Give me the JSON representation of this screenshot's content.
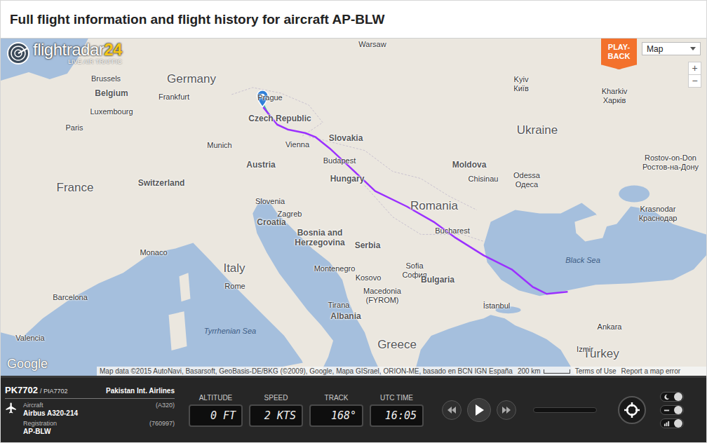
{
  "page": {
    "title": "Full flight information and flight history for aircraft AP-BLW"
  },
  "logo": {
    "name": "flightradar",
    "suffix": "24",
    "tagline": "LIVE AIR TRAFFIC"
  },
  "map": {
    "playback": [
      "PLAY-",
      "BACK"
    ],
    "type_select": {
      "value": "Map"
    },
    "zoom": [
      "+",
      "−"
    ],
    "labels": [
      {
        "lines": [
          "Warsaw"
        ],
        "kind": "city"
      },
      {
        "lines": [
          "Germany"
        ],
        "kind": "country"
      },
      {
        "lines": [
          "Brussels"
        ],
        "kind": "city"
      },
      {
        "lines": [
          "Belgium"
        ],
        "kind": "region"
      },
      {
        "lines": [
          "Frankfurt"
        ],
        "kind": "city"
      },
      {
        "lines": [
          "Luxembourg"
        ],
        "kind": "city"
      },
      {
        "lines": [
          "Paris"
        ],
        "kind": "city"
      },
      {
        "lines": [
          "France"
        ],
        "kind": "country"
      },
      {
        "lines": [
          "Prague"
        ],
        "kind": "city"
      },
      {
        "lines": [
          "Czech Republic"
        ],
        "kind": "region"
      },
      {
        "lines": [
          "Munich"
        ],
        "kind": "city"
      },
      {
        "lines": [
          "Vienna"
        ],
        "kind": "city"
      },
      {
        "lines": [
          "Slovakia"
        ],
        "kind": "region"
      },
      {
        "lines": [
          "Austria"
        ],
        "kind": "region"
      },
      {
        "lines": [
          "Switzerland"
        ],
        "kind": "region"
      },
      {
        "lines": [
          "Budapest"
        ],
        "kind": "city"
      },
      {
        "lines": [
          "Hungary"
        ],
        "kind": "region"
      },
      {
        "lines": [
          "Slovenia"
        ],
        "kind": "city"
      },
      {
        "lines": [
          "Zagreb"
        ],
        "kind": "city"
      },
      {
        "lines": [
          "Croatia"
        ],
        "kind": "region"
      },
      {
        "lines": [
          "Monaco"
        ],
        "kind": "city"
      },
      {
        "lines": [
          "Bosnia and",
          "Herzegovina"
        ],
        "kind": "region"
      },
      {
        "lines": [
          "Serbia"
        ],
        "kind": "region"
      },
      {
        "lines": [
          "Romania"
        ],
        "kind": "country"
      },
      {
        "lines": [
          "Bucharest"
        ],
        "kind": "city"
      },
      {
        "lines": [
          "Italy"
        ],
        "kind": "country"
      },
      {
        "lines": [
          "Rome"
        ],
        "kind": "city"
      },
      {
        "lines": [
          "Montenegro"
        ],
        "kind": "city"
      },
      {
        "lines": [
          "Kosovo"
        ],
        "kind": "city"
      },
      {
        "lines": [
          "Sofia",
          "София"
        ],
        "kind": "city"
      },
      {
        "lines": [
          "Bulgaria"
        ],
        "kind": "region"
      },
      {
        "lines": [
          "Tirana"
        ],
        "kind": "city"
      },
      {
        "lines": [
          "Macedonia",
          "(FYROM)"
        ],
        "kind": "city"
      },
      {
        "lines": [
          "Albania"
        ],
        "kind": "region"
      },
      {
        "lines": [
          "İstanbul"
        ],
        "kind": "city"
      },
      {
        "lines": [
          "Greece"
        ],
        "kind": "country"
      },
      {
        "lines": [
          "Barcelona"
        ],
        "kind": "city"
      },
      {
        "lines": [
          "Tyrrhenian Sea"
        ],
        "kind": "sea"
      },
      {
        "lines": [
          "Valencia"
        ],
        "kind": "city"
      },
      {
        "lines": [
          "Black Sea"
        ],
        "kind": "sea"
      },
      {
        "lines": [
          "Ankara"
        ],
        "kind": "city"
      },
      {
        "lines": [
          "Turkey"
        ],
        "kind": "country"
      },
      {
        "lines": [
          "Izmir"
        ],
        "kind": "city"
      },
      {
        "lines": [
          "Ukraine"
        ],
        "kind": "country"
      },
      {
        "lines": [
          "Kyiv",
          "Київ"
        ],
        "kind": "city"
      },
      {
        "lines": [
          "Kharkiv",
          "Харків"
        ],
        "kind": "city"
      },
      {
        "lines": [
          "Moldova"
        ],
        "kind": "region"
      },
      {
        "lines": [
          "Chisinau"
        ],
        "kind": "city"
      },
      {
        "lines": [
          "Odessa",
          "Одеса"
        ],
        "kind": "city"
      },
      {
        "lines": [
          "Rostov-on-Don",
          "Ростов-на-Дону"
        ],
        "kind": "city"
      },
      {
        "lines": [
          "Krasnodar",
          "Краснодар"
        ],
        "kind": "city"
      }
    ],
    "attribution": {
      "provider": "Google",
      "data": "Map data ©2015 AutoNavi, Basarsoft, GeoBasis-DE/BKG (©2009), Google, Mapa GISrael, ORION-ME, basado en BCN IGN España",
      "scale": "200 km",
      "terms": "Terms of Use",
      "report": "Report a map error"
    }
  },
  "flight": {
    "number": "PK7702",
    "alt_number": "/ PIA7702",
    "airline": "Pakistan Int. Airlines",
    "aircraft": {
      "label": "Aircraft",
      "code": "(A320)",
      "value": "Airbus A320-214"
    },
    "registration": {
      "label": "Registration",
      "code": "(760997)",
      "value": "AP-BLW"
    }
  },
  "gauges": [
    {
      "label": "ALTITUDE",
      "value": "0 FT"
    },
    {
      "label": "SPEED",
      "value": "2 KTS"
    },
    {
      "label": "TRACK",
      "value": "168°"
    },
    {
      "label": "UTC TIME",
      "value": "16:05"
    }
  ],
  "toggles": [
    {
      "on": true
    },
    {
      "on": true
    },
    {
      "on": true
    }
  ]
}
